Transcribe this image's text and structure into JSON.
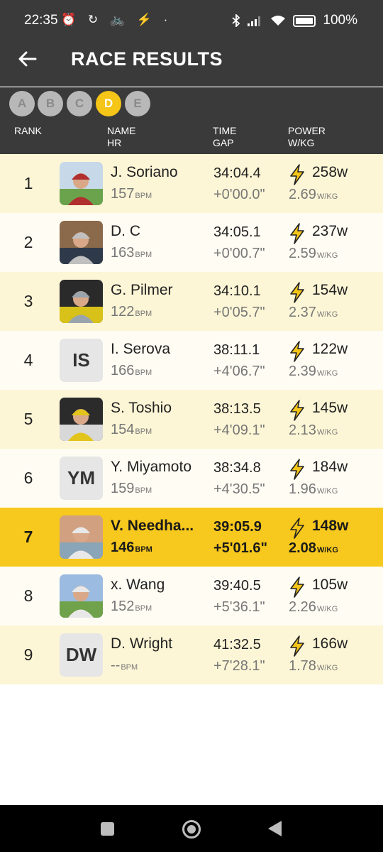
{
  "status": {
    "time": "22:35",
    "icons": "⏰ ↻ 🚲 ⚡ ·",
    "battery": "100%"
  },
  "header": {
    "title": "RACE RESULTS"
  },
  "filters": [
    {
      "label": "A",
      "active": false
    },
    {
      "label": "B",
      "active": false
    },
    {
      "label": "C",
      "active": false
    },
    {
      "label": "D",
      "active": true
    },
    {
      "label": "E",
      "active": false
    }
  ],
  "columns": {
    "rank": "RANK",
    "name": "NAME",
    "hr": "HR",
    "time": "TIME",
    "gap": "GAP",
    "power": "POWER",
    "wkg": "W/KG"
  },
  "units": {
    "bpm": "BPM",
    "wkg": "W/KG"
  },
  "rows": [
    {
      "rank": "1",
      "name": "J. Soriano",
      "hr": "157",
      "time": "34:04.4",
      "gap": "+0'00.0\"",
      "watts": "258w",
      "wkg": "2.69",
      "avatar": "photo",
      "initials": ""
    },
    {
      "rank": "2",
      "name": "D.  C",
      "hr": "163",
      "time": "34:05.1",
      "gap": "+0'00.7\"",
      "watts": "237w",
      "wkg": "2.59",
      "avatar": "photo",
      "initials": ""
    },
    {
      "rank": "3",
      "name": "G. Pilmer",
      "hr": "122",
      "time": "34:10.1",
      "gap": "+0'05.7\"",
      "watts": "154w",
      "wkg": "2.37",
      "avatar": "photo",
      "initials": ""
    },
    {
      "rank": "4",
      "name": "I. Serova",
      "hr": "166",
      "time": "38:11.1",
      "gap": "+4'06.7\"",
      "watts": "122w",
      "wkg": "2.39",
      "avatar": "initials",
      "initials": "IS"
    },
    {
      "rank": "5",
      "name": "S. Toshio",
      "hr": "154",
      "time": "38:13.5",
      "gap": "+4'09.1\"",
      "watts": "145w",
      "wkg": "2.13",
      "avatar": "photo",
      "initials": ""
    },
    {
      "rank": "6",
      "name": "Y. Miyamoto",
      "hr": "159",
      "time": "38:34.8",
      "gap": "+4'30.5\"",
      "watts": "184w",
      "wkg": "1.96",
      "avatar": "initials",
      "initials": "YM"
    },
    {
      "rank": "7",
      "name": "V. Needha...",
      "hr": "146",
      "time": "39:05.9",
      "gap": "+5'01.6\"",
      "watts": "148w",
      "wkg": "2.08",
      "avatar": "photo",
      "initials": "",
      "highlight": true
    },
    {
      "rank": "8",
      "name": "x. Wang",
      "hr": "152",
      "time": "39:40.5",
      "gap": "+5'36.1\"",
      "watts": "105w",
      "wkg": "2.26",
      "avatar": "photo",
      "initials": ""
    },
    {
      "rank": "9",
      "name": "D. Wright",
      "hr": "--",
      "time": "41:32.5",
      "gap": "+7'28.1\"",
      "watts": "166w",
      "wkg": "1.78",
      "avatar": "initials",
      "initials": "DW"
    }
  ],
  "colors": {
    "accent": "#f7c81d",
    "header_bg": "#3a3a3a",
    "row_odd": "#fdf6d6",
    "row_even": "#fffcf3"
  }
}
